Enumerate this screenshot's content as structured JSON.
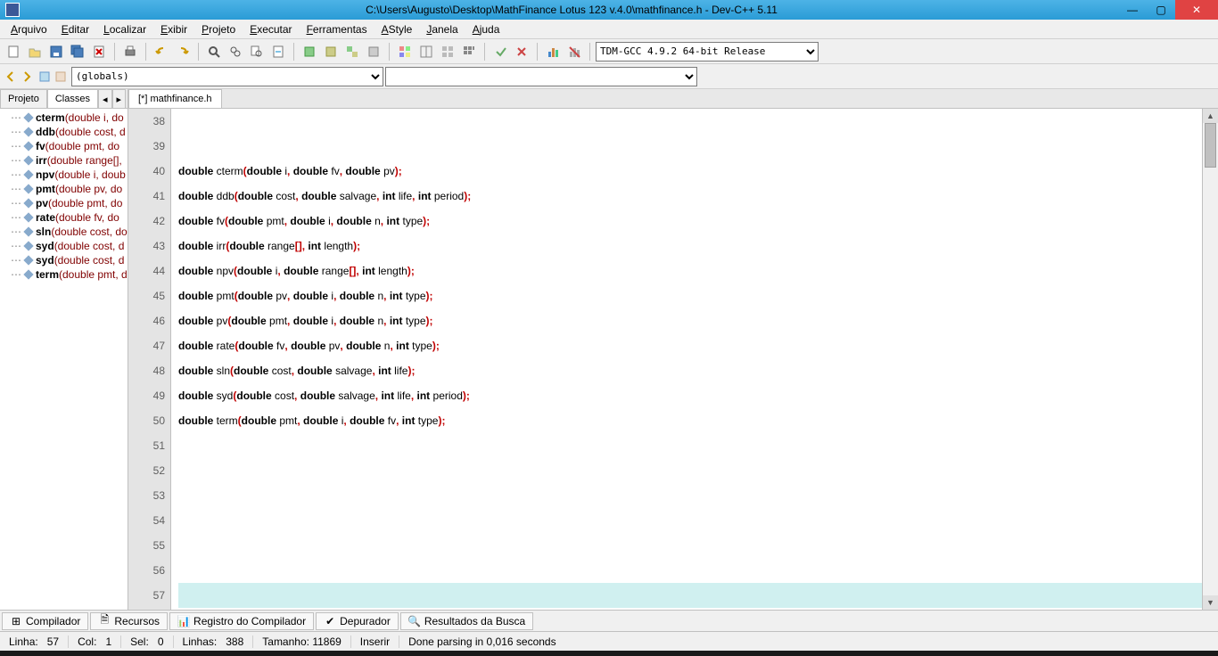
{
  "titlebar": {
    "title": "C:\\Users\\Augusto\\Desktop\\MathFinance Lotus 123 v.4.0\\mathfinance.h - Dev-C++ 5.11"
  },
  "menu": {
    "items": [
      "Arquivo",
      "Editar",
      "Localizar",
      "Exibir",
      "Projeto",
      "Executar",
      "Ferramentas",
      "AStyle",
      "Janela",
      "Ajuda"
    ]
  },
  "toolbar": {
    "compiler_select": "TDM-GCC 4.9.2 64-bit Release"
  },
  "toolbar2": {
    "scope_select": "(globals)"
  },
  "leftpanel": {
    "tabs": [
      "Projeto",
      "Classes"
    ],
    "active_tab": "Classes",
    "functions": [
      {
        "name": "cterm",
        "sig": "(double i, do"
      },
      {
        "name": "ddb",
        "sig": "(double cost, d"
      },
      {
        "name": "fv",
        "sig": "(double pmt, do"
      },
      {
        "name": "irr",
        "sig": "(double range[],"
      },
      {
        "name": "npv",
        "sig": "(double i, doub"
      },
      {
        "name": "pmt",
        "sig": "(double pv, do"
      },
      {
        "name": "pv",
        "sig": "(double pmt, do"
      },
      {
        "name": "rate",
        "sig": "(double fv, do"
      },
      {
        "name": "sln",
        "sig": "(double cost, do"
      },
      {
        "name": "syd",
        "sig": "(double cost, d"
      },
      {
        "name": "syd",
        "sig": "(double cost, d"
      },
      {
        "name": "term",
        "sig": "(double pmt, d"
      }
    ]
  },
  "editor": {
    "tab_label": "[*] mathfinance.h",
    "first_line": 38,
    "lines": [
      {
        "n": 38,
        "tokens": []
      },
      {
        "n": 39,
        "tokens": []
      },
      {
        "n": 40,
        "tokens": [
          {
            "t": "kw",
            "s": "double"
          },
          {
            "t": "sp",
            "s": " "
          },
          {
            "t": "fn",
            "s": "cterm"
          },
          {
            "t": "punct",
            "s": "("
          },
          {
            "t": "kw",
            "s": "double"
          },
          {
            "t": "sp",
            "s": " "
          },
          {
            "t": "fn",
            "s": "i"
          },
          {
            "t": "punct",
            "s": ","
          },
          {
            "t": "sp",
            "s": " "
          },
          {
            "t": "kw",
            "s": "double"
          },
          {
            "t": "sp",
            "s": " "
          },
          {
            "t": "fn",
            "s": "fv"
          },
          {
            "t": "punct",
            "s": ","
          },
          {
            "t": "sp",
            "s": " "
          },
          {
            "t": "kw",
            "s": "double"
          },
          {
            "t": "sp",
            "s": " "
          },
          {
            "t": "fn",
            "s": "pv"
          },
          {
            "t": "punct",
            "s": ");"
          }
        ]
      },
      {
        "n": 41,
        "tokens": [
          {
            "t": "kw",
            "s": "double"
          },
          {
            "t": "sp",
            "s": " "
          },
          {
            "t": "fn",
            "s": "ddb"
          },
          {
            "t": "punct",
            "s": "("
          },
          {
            "t": "kw",
            "s": "double"
          },
          {
            "t": "sp",
            "s": " "
          },
          {
            "t": "fn",
            "s": "cost"
          },
          {
            "t": "punct",
            "s": ","
          },
          {
            "t": "sp",
            "s": " "
          },
          {
            "t": "kw",
            "s": "double"
          },
          {
            "t": "sp",
            "s": " "
          },
          {
            "t": "fn",
            "s": "salvage"
          },
          {
            "t": "punct",
            "s": ","
          },
          {
            "t": "sp",
            "s": " "
          },
          {
            "t": "kw",
            "s": "int"
          },
          {
            "t": "sp",
            "s": " "
          },
          {
            "t": "fn",
            "s": "life"
          },
          {
            "t": "punct",
            "s": ","
          },
          {
            "t": "sp",
            "s": " "
          },
          {
            "t": "kw",
            "s": "int"
          },
          {
            "t": "sp",
            "s": " "
          },
          {
            "t": "fn",
            "s": "period"
          },
          {
            "t": "punct",
            "s": ");"
          }
        ]
      },
      {
        "n": 42,
        "tokens": [
          {
            "t": "kw",
            "s": "double"
          },
          {
            "t": "sp",
            "s": " "
          },
          {
            "t": "fn",
            "s": "fv"
          },
          {
            "t": "punct",
            "s": "("
          },
          {
            "t": "kw",
            "s": "double"
          },
          {
            "t": "sp",
            "s": " "
          },
          {
            "t": "fn",
            "s": "pmt"
          },
          {
            "t": "punct",
            "s": ","
          },
          {
            "t": "sp",
            "s": " "
          },
          {
            "t": "kw",
            "s": "double"
          },
          {
            "t": "sp",
            "s": " "
          },
          {
            "t": "fn",
            "s": "i"
          },
          {
            "t": "punct",
            "s": ","
          },
          {
            "t": "sp",
            "s": " "
          },
          {
            "t": "kw",
            "s": "double"
          },
          {
            "t": "sp",
            "s": " "
          },
          {
            "t": "fn",
            "s": "n"
          },
          {
            "t": "punct",
            "s": ","
          },
          {
            "t": "sp",
            "s": " "
          },
          {
            "t": "kw",
            "s": "int"
          },
          {
            "t": "sp",
            "s": " "
          },
          {
            "t": "fn",
            "s": "type"
          },
          {
            "t": "punct",
            "s": ");"
          }
        ]
      },
      {
        "n": 43,
        "tokens": [
          {
            "t": "kw",
            "s": "double"
          },
          {
            "t": "sp",
            "s": " "
          },
          {
            "t": "fn",
            "s": "irr"
          },
          {
            "t": "punct",
            "s": "("
          },
          {
            "t": "kw",
            "s": "double"
          },
          {
            "t": "sp",
            "s": " "
          },
          {
            "t": "fn",
            "s": "range"
          },
          {
            "t": "punct",
            "s": "[],"
          },
          {
            "t": "sp",
            "s": " "
          },
          {
            "t": "kw",
            "s": "int"
          },
          {
            "t": "sp",
            "s": " "
          },
          {
            "t": "fn",
            "s": "length"
          },
          {
            "t": "punct",
            "s": ");"
          }
        ]
      },
      {
        "n": 44,
        "tokens": [
          {
            "t": "kw",
            "s": "double"
          },
          {
            "t": "sp",
            "s": " "
          },
          {
            "t": "fn",
            "s": "npv"
          },
          {
            "t": "punct",
            "s": "("
          },
          {
            "t": "kw",
            "s": "double"
          },
          {
            "t": "sp",
            "s": " "
          },
          {
            "t": "fn",
            "s": "i"
          },
          {
            "t": "punct",
            "s": ","
          },
          {
            "t": "sp",
            "s": " "
          },
          {
            "t": "kw",
            "s": "double"
          },
          {
            "t": "sp",
            "s": " "
          },
          {
            "t": "fn",
            "s": "range"
          },
          {
            "t": "punct",
            "s": "[],"
          },
          {
            "t": "sp",
            "s": " "
          },
          {
            "t": "kw",
            "s": "int"
          },
          {
            "t": "sp",
            "s": " "
          },
          {
            "t": "fn",
            "s": "length"
          },
          {
            "t": "punct",
            "s": ");"
          }
        ]
      },
      {
        "n": 45,
        "tokens": [
          {
            "t": "kw",
            "s": "double"
          },
          {
            "t": "sp",
            "s": " "
          },
          {
            "t": "fn",
            "s": "pmt"
          },
          {
            "t": "punct",
            "s": "("
          },
          {
            "t": "kw",
            "s": "double"
          },
          {
            "t": "sp",
            "s": " "
          },
          {
            "t": "fn",
            "s": "pv"
          },
          {
            "t": "punct",
            "s": ","
          },
          {
            "t": "sp",
            "s": " "
          },
          {
            "t": "kw",
            "s": "double"
          },
          {
            "t": "sp",
            "s": " "
          },
          {
            "t": "fn",
            "s": "i"
          },
          {
            "t": "punct",
            "s": ","
          },
          {
            "t": "sp",
            "s": " "
          },
          {
            "t": "kw",
            "s": "double"
          },
          {
            "t": "sp",
            "s": " "
          },
          {
            "t": "fn",
            "s": "n"
          },
          {
            "t": "punct",
            "s": ","
          },
          {
            "t": "sp",
            "s": " "
          },
          {
            "t": "kw",
            "s": "int"
          },
          {
            "t": "sp",
            "s": " "
          },
          {
            "t": "fn",
            "s": "type"
          },
          {
            "t": "punct",
            "s": ");"
          }
        ]
      },
      {
        "n": 46,
        "tokens": [
          {
            "t": "kw",
            "s": "double"
          },
          {
            "t": "sp",
            "s": " "
          },
          {
            "t": "fn",
            "s": "pv"
          },
          {
            "t": "punct",
            "s": "("
          },
          {
            "t": "kw",
            "s": "double"
          },
          {
            "t": "sp",
            "s": " "
          },
          {
            "t": "fn",
            "s": "pmt"
          },
          {
            "t": "punct",
            "s": ","
          },
          {
            "t": "sp",
            "s": " "
          },
          {
            "t": "kw",
            "s": "double"
          },
          {
            "t": "sp",
            "s": " "
          },
          {
            "t": "fn",
            "s": "i"
          },
          {
            "t": "punct",
            "s": ","
          },
          {
            "t": "sp",
            "s": " "
          },
          {
            "t": "kw",
            "s": "double"
          },
          {
            "t": "sp",
            "s": " "
          },
          {
            "t": "fn",
            "s": "n"
          },
          {
            "t": "punct",
            "s": ","
          },
          {
            "t": "sp",
            "s": " "
          },
          {
            "t": "kw",
            "s": "int"
          },
          {
            "t": "sp",
            "s": " "
          },
          {
            "t": "fn",
            "s": "type"
          },
          {
            "t": "punct",
            "s": ");"
          }
        ]
      },
      {
        "n": 47,
        "tokens": [
          {
            "t": "kw",
            "s": "double"
          },
          {
            "t": "sp",
            "s": " "
          },
          {
            "t": "fn",
            "s": "rate"
          },
          {
            "t": "punct",
            "s": "("
          },
          {
            "t": "kw",
            "s": "double"
          },
          {
            "t": "sp",
            "s": " "
          },
          {
            "t": "fn",
            "s": "fv"
          },
          {
            "t": "punct",
            "s": ","
          },
          {
            "t": "sp",
            "s": " "
          },
          {
            "t": "kw",
            "s": "double"
          },
          {
            "t": "sp",
            "s": " "
          },
          {
            "t": "fn",
            "s": "pv"
          },
          {
            "t": "punct",
            "s": ","
          },
          {
            "t": "sp",
            "s": " "
          },
          {
            "t": "kw",
            "s": "double"
          },
          {
            "t": "sp",
            "s": " "
          },
          {
            "t": "fn",
            "s": "n"
          },
          {
            "t": "punct",
            "s": ","
          },
          {
            "t": "sp",
            "s": " "
          },
          {
            "t": "kw",
            "s": "int"
          },
          {
            "t": "sp",
            "s": " "
          },
          {
            "t": "fn",
            "s": "type"
          },
          {
            "t": "punct",
            "s": ");"
          }
        ]
      },
      {
        "n": 48,
        "tokens": [
          {
            "t": "kw",
            "s": "double"
          },
          {
            "t": "sp",
            "s": " "
          },
          {
            "t": "fn",
            "s": "sln"
          },
          {
            "t": "punct",
            "s": "("
          },
          {
            "t": "kw",
            "s": "double"
          },
          {
            "t": "sp",
            "s": " "
          },
          {
            "t": "fn",
            "s": "cost"
          },
          {
            "t": "punct",
            "s": ","
          },
          {
            "t": "sp",
            "s": " "
          },
          {
            "t": "kw",
            "s": "double"
          },
          {
            "t": "sp",
            "s": " "
          },
          {
            "t": "fn",
            "s": "salvage"
          },
          {
            "t": "punct",
            "s": ","
          },
          {
            "t": "sp",
            "s": " "
          },
          {
            "t": "kw",
            "s": "int"
          },
          {
            "t": "sp",
            "s": " "
          },
          {
            "t": "fn",
            "s": "life"
          },
          {
            "t": "punct",
            "s": ");"
          }
        ]
      },
      {
        "n": 49,
        "tokens": [
          {
            "t": "kw",
            "s": "double"
          },
          {
            "t": "sp",
            "s": " "
          },
          {
            "t": "fn",
            "s": "syd"
          },
          {
            "t": "punct",
            "s": "("
          },
          {
            "t": "kw",
            "s": "double"
          },
          {
            "t": "sp",
            "s": " "
          },
          {
            "t": "fn",
            "s": "cost"
          },
          {
            "t": "punct",
            "s": ","
          },
          {
            "t": "sp",
            "s": " "
          },
          {
            "t": "kw",
            "s": "double"
          },
          {
            "t": "sp",
            "s": " "
          },
          {
            "t": "fn",
            "s": "salvage"
          },
          {
            "t": "punct",
            "s": ","
          },
          {
            "t": "sp",
            "s": " "
          },
          {
            "t": "kw",
            "s": "int"
          },
          {
            "t": "sp",
            "s": " "
          },
          {
            "t": "fn",
            "s": "life"
          },
          {
            "t": "punct",
            "s": ","
          },
          {
            "t": "sp",
            "s": " "
          },
          {
            "t": "kw",
            "s": "int"
          },
          {
            "t": "sp",
            "s": " "
          },
          {
            "t": "fn",
            "s": "period"
          },
          {
            "t": "punct",
            "s": ");"
          }
        ]
      },
      {
        "n": 50,
        "tokens": [
          {
            "t": "kw",
            "s": "double"
          },
          {
            "t": "sp",
            "s": " "
          },
          {
            "t": "fn",
            "s": "term"
          },
          {
            "t": "punct",
            "s": "("
          },
          {
            "t": "kw",
            "s": "double"
          },
          {
            "t": "sp",
            "s": " "
          },
          {
            "t": "fn",
            "s": "pmt"
          },
          {
            "t": "punct",
            "s": ","
          },
          {
            "t": "sp",
            "s": " "
          },
          {
            "t": "kw",
            "s": "double"
          },
          {
            "t": "sp",
            "s": " "
          },
          {
            "t": "fn",
            "s": "i"
          },
          {
            "t": "punct",
            "s": ","
          },
          {
            "t": "sp",
            "s": " "
          },
          {
            "t": "kw",
            "s": "double"
          },
          {
            "t": "sp",
            "s": " "
          },
          {
            "t": "fn",
            "s": "fv"
          },
          {
            "t": "punct",
            "s": ","
          },
          {
            "t": "sp",
            "s": " "
          },
          {
            "t": "kw",
            "s": "int"
          },
          {
            "t": "sp",
            "s": " "
          },
          {
            "t": "fn",
            "s": "type"
          },
          {
            "t": "punct",
            "s": ");"
          }
        ]
      },
      {
        "n": 51,
        "tokens": []
      },
      {
        "n": 52,
        "tokens": []
      },
      {
        "n": 53,
        "tokens": []
      },
      {
        "n": 54,
        "tokens": []
      },
      {
        "n": 55,
        "tokens": []
      },
      {
        "n": 56,
        "tokens": []
      },
      {
        "n": 57,
        "tokens": [],
        "cursor": true
      }
    ]
  },
  "bottomtabs": {
    "items": [
      "Compilador",
      "Recursos",
      "Registro do Compilador",
      "Depurador",
      "Resultados da Busca"
    ]
  },
  "statusbar": {
    "line_label": "Linha:",
    "line_value": "57",
    "col_label": "Col:",
    "col_value": "1",
    "sel_label": "Sel:",
    "sel_value": "0",
    "lines_label": "Linhas:",
    "lines_value": "388",
    "size_label": "Tamanho:",
    "size_value": "11869",
    "mode": "Inserir",
    "parse": "Done parsing in 0,016 seconds"
  }
}
